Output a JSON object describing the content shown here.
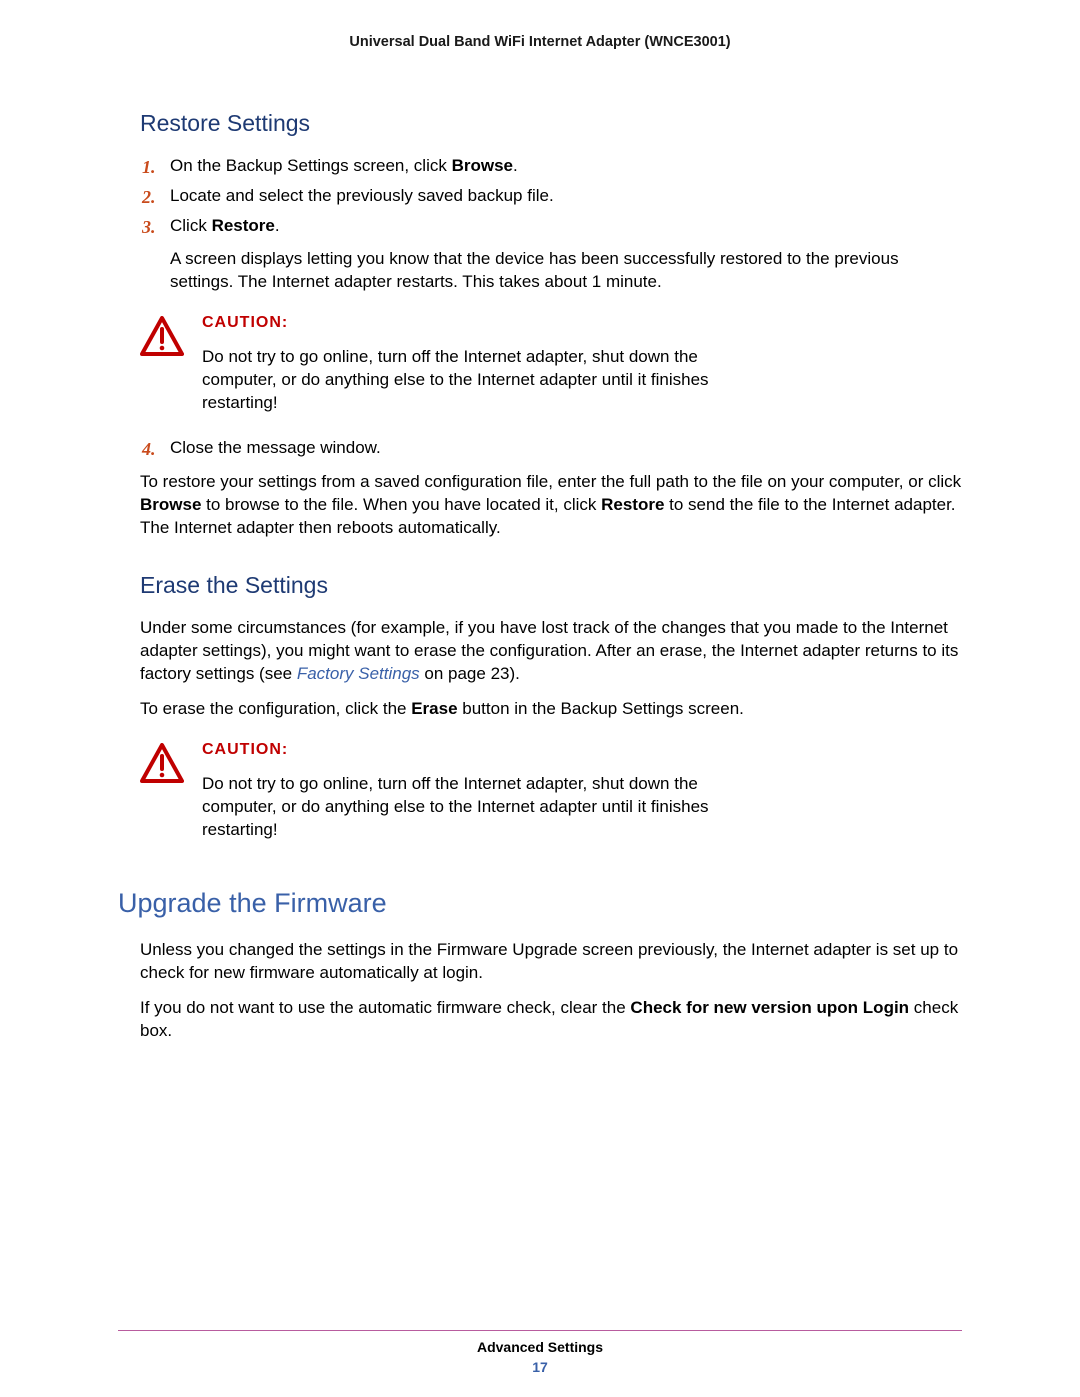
{
  "header": {
    "title": "Universal Dual Band WiFi Internet Adapter (WNCE3001)"
  },
  "sections": {
    "restore": {
      "title": "Restore Settings",
      "step1_pre": "On the Backup Settings screen, click ",
      "step1_bold": "Browse",
      "step1_post": ".",
      "step2": "Locate and select the previously saved backup file.",
      "step3_pre": "Click ",
      "step3_bold": "Restore",
      "step3_post": ".",
      "step3_body": "A screen displays letting you know that the device has been successfully restored to the previous settings. The Internet adapter restarts. This takes about 1 minute.",
      "caution_label": "CAUTION:",
      "caution_text": "Do not try to go online, turn off the Internet adapter, shut down the computer, or do anything else to the Internet adapter until it finishes restarting!",
      "step4": "Close the message window.",
      "para_pre": "To restore your settings from a saved configuration file, enter the full path to the file on your computer, or click ",
      "para_b1": "Browse",
      "para_mid": " to browse to the file. When you have located it, click ",
      "para_b2": "Restore",
      "para_post": " to send the file to the Internet adapter. The Internet adapter then reboots automatically."
    },
    "erase": {
      "title": "Erase the Settings",
      "p1_pre": "Under some circumstances (for example, if you have lost track of the changes that you made to the Internet adapter settings), you might want to erase the configuration. After an erase, the Internet adapter returns to its factory settings (see ",
      "p1_link": "Factory Settings",
      "p1_post": " on page 23).",
      "p2_pre": "To erase the configuration, click the ",
      "p2_bold": "Erase",
      "p2_post": " button in the Backup Settings screen.",
      "caution_label": "CAUTION:",
      "caution_text": "Do not try to go online, turn off the Internet adapter, shut down the computer, or do anything else to the Internet adapter until it finishes restarting!"
    },
    "upgrade": {
      "title": "Upgrade the Firmware",
      "p1": "Unless you changed the settings in the Firmware Upgrade screen previously, the Internet adapter is set up to check for new firmware automatically at login.",
      "p2_pre": "If you do not want to use the automatic firmware check, clear the ",
      "p2_bold": "Check for new version upon Login",
      "p2_post": " check box."
    }
  },
  "footer": {
    "section": "Advanced Settings",
    "page": "17"
  }
}
